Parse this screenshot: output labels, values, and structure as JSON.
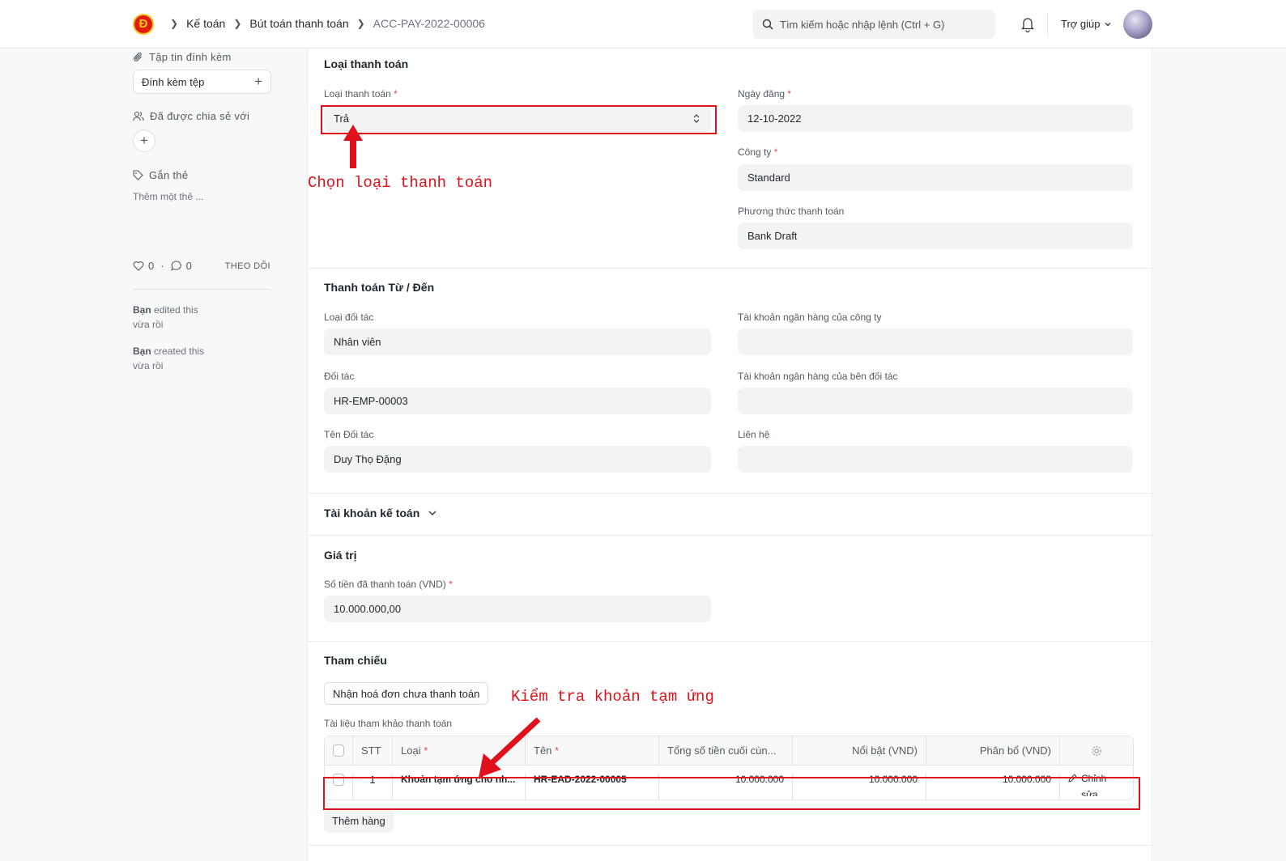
{
  "navbar": {
    "logo_text": "Đ",
    "breadcrumbs": [
      "Kế toán",
      "Bút toán thanh toán",
      "ACC-PAY-2022-00006"
    ],
    "search_placeholder": "Tìm kiếm hoặc nhập lệnh (Ctrl + G)",
    "help_label": "Trợ giúp"
  },
  "sidebar": {
    "attachments_label": "Tập tin đính kèm",
    "attach_button": "Đính kèm tệp",
    "shared_label": "Đã được chia sẻ với",
    "tags_label": "Gắn thẻ",
    "add_tag": "Thêm một thẻ ...",
    "likes": "0",
    "comments": "0",
    "follow": "THEO DÕI",
    "activity": [
      {
        "user": "Bạn",
        "action": "edited this",
        "time": "vừa rồi"
      },
      {
        "user": "Bạn",
        "action": "created this",
        "time": "vừa rồi"
      }
    ]
  },
  "form": {
    "payment_type_section": {
      "title": "Loại thanh toán",
      "payment_type_label": "Loại thanh toán",
      "payment_type_value": "Trả",
      "posting_date_label": "Ngày đăng",
      "posting_date_value": "12-10-2022",
      "company_label": "Công ty",
      "company_value": "Standard",
      "mode_label": "Phương thức thanh toán",
      "mode_value": "Bank Draft"
    },
    "party_section": {
      "title": "Thanh toán Từ / Đến",
      "party_type_label": "Loại đối tác",
      "party_type_value": "Nhân viên",
      "company_bank_label": "Tài khoản ngân hàng của công ty",
      "company_bank_value": "",
      "party_label": "Đối tác",
      "party_value": "HR-EMP-00003",
      "party_bank_label": "Tài khoản ngân hàng của bên đối tác",
      "party_bank_value": "",
      "party_name_label": "Tên Đối tác",
      "party_name_value": "Duy Thọ Đặng",
      "contact_label": "Liên hệ",
      "contact_value": ""
    },
    "accounts_section": {
      "title": "Tài khoản kế toán"
    },
    "amount_section": {
      "title": "Giá trị",
      "paid_amount_label": "Số tiền đã thanh toán (VND)",
      "paid_amount_value": "10.000.000,00"
    },
    "reference_section": {
      "title": "Tham chiếu",
      "get_invoices_button": "Nhận hoá đơn chưa thanh toán",
      "table_label": "Tài liệu tham khảo thanh toán",
      "columns": [
        "STT",
        "Loại",
        "Tên",
        "Tổng số tiền cuối cùn...",
        "Nổi bật (VND)",
        "Phân bổ (VND)"
      ],
      "rows": [
        {
          "idx": "1",
          "type": "Khoản tạm ứng cho nh...",
          "name": "HR-EAD-2022-00005",
          "grand_total": "10.000.000",
          "outstanding": "10.000.000",
          "allocated": "10.000.000",
          "edit": "Chỉnh sửa"
        }
      ],
      "add_row_button": "Thêm hàng"
    }
  },
  "annotations": {
    "choose_type": "Chọn loại thanh toán",
    "check_advance": "Kiểm tra khoản tạm ứng"
  },
  "colors": {
    "annotation": "#e0111b",
    "required": "#e24c4c"
  }
}
